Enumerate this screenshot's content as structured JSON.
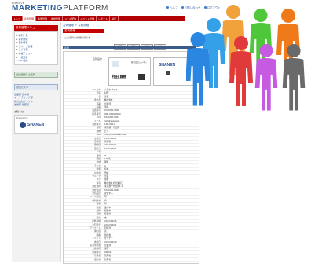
{
  "header": {
    "brand_small": "BIZMOVE",
    "brand_marketing": "MARKETING",
    "brand_platform": "PLATFORM",
    "top_links": [
      "ヘルプ",
      "お問い合わせ",
      "ログアウト"
    ]
  },
  "tabs": [
    {
      "label": "トップ",
      "active": false
    },
    {
      "label": "名刺管理",
      "active": true
    },
    {
      "label": "案件管理",
      "active": false
    },
    {
      "label": "商談管理",
      "active": false
    },
    {
      "label": "メール配信",
      "active": false
    },
    {
      "label": "イベント管理",
      "active": false
    },
    {
      "label": "レポート",
      "active": false
    },
    {
      "label": "設定",
      "active": false
    }
  ],
  "sidebar": {
    "menu_header": "名刺管理メニュー",
    "menu_items": [
      "名刺一覧",
      "名刺登録",
      "名刺検索",
      "グループ管理",
      "タグ管理",
      "重複チェック",
      "一括更新",
      "CSV出力"
    ],
    "section1": "最近閲覧した名刺",
    "section2": "お気に入り",
    "list_items": [
      "営業部 田中様",
      "マーケティング部",
      "株式会社サンプル",
      "技術部 佐藤様"
    ],
    "plain_label": "お知らせ",
    "powered_label": "Powered by",
    "powered_brand": "SHANEN"
  },
  "main": {
    "breadcrumb": "名刺管理 > 名刺詳細",
    "title": "名刺詳細",
    "subtitle": "この名刺の詳細情報です",
    "content_header": "名刺",
    "buttons": [
      "編集",
      "削除",
      "印刷",
      "戻る"
    ],
    "card_label": "名刺画像",
    "card_name": "村田 直樹",
    "card_company": "株式会社シャネン",
    "card_logo_text": "SHANEN",
    "fields": [
      {
        "label": "フリガナ",
        "value": "ムラタ ナオキ"
      },
      {
        "label": "氏名",
        "value": "村田"
      },
      {
        "label": "名",
        "value": "直樹"
      },
      {
        "label": "会社名",
        "value": "株式会社"
      },
      {
        "label": "部署",
        "value": "営業部"
      },
      {
        "label": "役職",
        "value": "部長"
      },
      {
        "label": "電話番号",
        "value": "03-0000-0000"
      },
      {
        "label": "携帯番号",
        "value": "090-0000-0000"
      },
      {
        "label": "FAX",
        "value": "03-0000-0001"
      },
      {
        "label": "メール",
        "value": "info@example"
      },
      {
        "label": "郵便番号",
        "value": "100-0001"
      },
      {
        "label": "住所",
        "value": "東京都千代田区"
      },
      {
        "label": "建物",
        "value": "ビル"
      },
      {
        "label": "URL",
        "value": "http://www.example"
      },
      {
        "label": "交換日",
        "value": "2012/01/01"
      },
      {
        "label": "登録者",
        "value": "管理者"
      },
      {
        "label": "登録日",
        "value": "2012/01/01"
      },
      {
        "label": "更新日",
        "value": "2012/01/01"
      },
      {
        "label": "メモ",
        "value": ""
      },
      {
        "label": "業種",
        "value": "IT"
      },
      {
        "label": "規模",
        "value": "100名"
      },
      {
        "label": "地域",
        "value": "関東"
      },
      {
        "label": "ランク",
        "value": "A"
      },
      {
        "label": "状態",
        "value": "有効"
      },
      {
        "label": "担当者",
        "value": "田中"
      },
      {
        "label": "グループ",
        "value": "営業"
      },
      {
        "label": "タグ",
        "value": "重要"
      },
      {
        "label": "備考",
        "value": "株式会社の営業窓口"
      },
      {
        "label": "会社住所",
        "value": "東京都千代田区1-1"
      },
      {
        "label": "会社電話",
        "value": "03-0000-0000"
      },
      {
        "label": "受信設定",
        "value": "受信する"
      },
      {
        "label": "メール配信",
        "value": "可"
      },
      {
        "label": "資料請求",
        "value": "有"
      },
      {
        "label": "来場",
        "value": "有"
      },
      {
        "label": "商談",
        "value": "進行中"
      },
      {
        "label": "案件",
        "value": "提案中"
      },
      {
        "label": "見積",
        "value": "提出済"
      },
      {
        "label": "受注",
        "value": "未"
      },
      {
        "label": "最終接触",
        "value": "2012/01/15"
      },
      {
        "label": "次回予定",
        "value": "2012/02/01"
      },
      {
        "label": "アンケート",
        "value": "回答済"
      },
      {
        "label": "関心度",
        "value": "高"
      },
      {
        "label": "経路",
        "value": "展示会"
      },
      {
        "label": "イベント",
        "value": "セミナー"
      },
      {
        "label": "参加日",
        "value": "2012/01/10"
      },
      {
        "label": "名刺交換者",
        "value": "営業部"
      },
      {
        "label": "交換場所",
        "value": "東京"
      },
      {
        "label": "管理番号",
        "value": "00001"
      },
      {
        "label": "作成者",
        "value": "管理者"
      },
      {
        "label": "更新者",
        "value": "管理者"
      }
    ]
  },
  "colors": {
    "brand_red": "#c40000",
    "header_blue": "#3a5a8a",
    "link_blue": "#2a5aa0"
  },
  "people_colors": [
    "#f2a23a",
    "#2a86e0",
    "#4ec83a",
    "#e03a3a",
    "#c65ae0",
    "#f07a1a",
    "#6a6a6a",
    "#33a0e8"
  ]
}
